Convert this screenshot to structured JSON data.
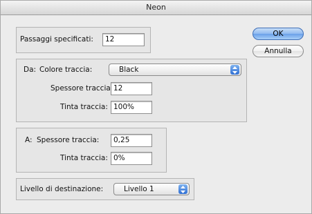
{
  "window": {
    "title": "Neon"
  },
  "steps": {
    "label": "Passaggi specificati:",
    "value": "12"
  },
  "from": {
    "prefix": "Da:",
    "color_label": "Colore traccia:",
    "color_value": "Black",
    "weight_label": "Spessore traccia:",
    "weight_value": "12",
    "tint_label": "Tinta traccia:",
    "tint_value": "100%"
  },
  "to": {
    "prefix": "A:",
    "weight_label": "Spessore traccia:",
    "weight_value": "0,25",
    "tint_label": "Tinta traccia:",
    "tint_value": "0%"
  },
  "destination": {
    "label": "Livello di destinazione:",
    "value": "Livello 1"
  },
  "buttons": {
    "ok": "OK",
    "cancel": "Annulla"
  },
  "colors": {
    "accent": "#6aa0e8",
    "popup_arrow": "#2f6fd4"
  },
  "icons": {
    "popup_arrows": "up-down-arrows-icon"
  }
}
